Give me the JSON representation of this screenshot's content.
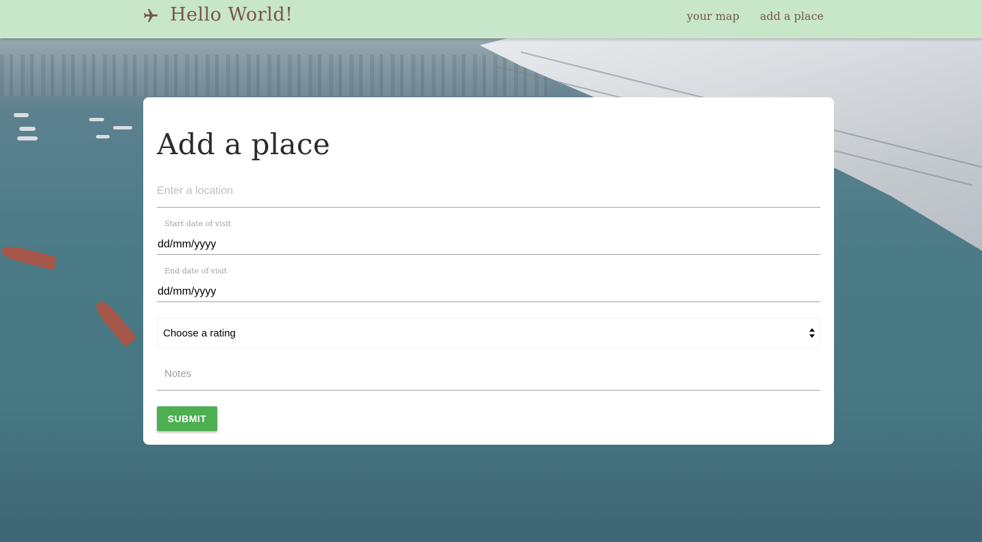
{
  "nav": {
    "brand": "Hello World!",
    "brand_icon": "airplane-icon",
    "links": [
      "your map",
      "add a place"
    ]
  },
  "form": {
    "title": "Add a place",
    "location_placeholder": "Enter a location",
    "start_date_label": "Start date of visit",
    "start_date_value": "dd/mm/yyyy",
    "end_date_label": "End date of visit",
    "end_date_value": "dd/mm/yyyy",
    "rating_selected": "Choose a rating",
    "notes_placeholder": "Notes",
    "submit_label": "SUBMIT"
  },
  "colors": {
    "navbar": "#c8e6c9",
    "brand_text": "#795548",
    "submit_button": "#4caf50"
  }
}
